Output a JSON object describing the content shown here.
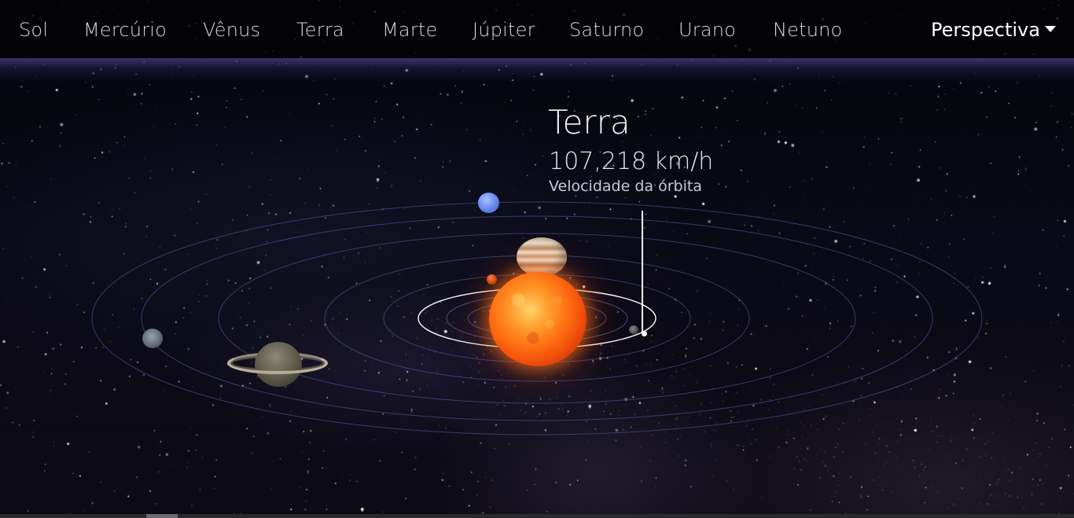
{
  "nav": {
    "items": [
      {
        "label": "Sol"
      },
      {
        "label": "Mercúrio"
      },
      {
        "label": "Vênus"
      },
      {
        "label": "Terra"
      },
      {
        "label": "Marte"
      },
      {
        "label": "Júpiter"
      },
      {
        "label": "Saturno"
      },
      {
        "label": "Urano"
      },
      {
        "label": "Netuno"
      }
    ],
    "perspective_label": "Perspectiva",
    "perspective_icon": "caret-down-icon"
  },
  "info": {
    "planet_name": "Terra",
    "orbital_speed": "107,218 km/h",
    "speed_caption": "Velocidade da órbita"
  },
  "colors": {
    "nav_text": "#d8d8e2",
    "accent_glow": "#463c82",
    "orbit_line": "#5a5a9a",
    "selected_orbit": "#ffffff",
    "sun": "#ff6a10"
  },
  "scene": {
    "selected_planet": "Terra"
  }
}
